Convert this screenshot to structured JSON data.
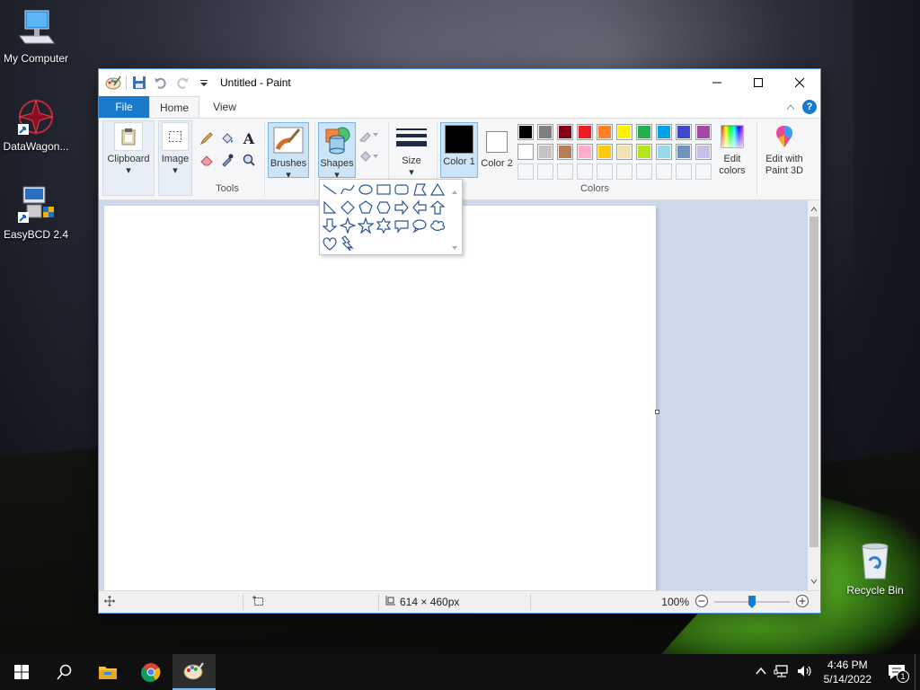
{
  "desktop": {
    "icons": [
      {
        "label": "My Computer",
        "icon": "computer-icon"
      },
      {
        "label": "DataWagon...",
        "icon": "datawagon-icon"
      },
      {
        "label": "EasyBCD 2.4",
        "icon": "easybcd-icon"
      },
      {
        "label": "Recycle Bin",
        "icon": "recycle-bin-icon"
      }
    ]
  },
  "window": {
    "title": "Untitled - Paint",
    "tabs": {
      "file": "File",
      "home": "Home",
      "view": "View"
    },
    "ribbon": {
      "clipboard": "Clipboard",
      "image": "Image",
      "tools_group": "Tools",
      "brushes": "Brushes",
      "shapes": "Shapes",
      "size": "Size",
      "color1": "Color 1",
      "color2": "Color 2",
      "edit_colors": "Edit colors",
      "edit_paint3d": "Edit with Paint 3D",
      "colors_group": "Colors"
    },
    "palette_row1": [
      "#000000",
      "#7f7f7f",
      "#880015",
      "#ed1c24",
      "#ff7f27",
      "#fff200",
      "#22b14c",
      "#00a2e8",
      "#3f48cc",
      "#a349a4"
    ],
    "palette_row2": [
      "#ffffff",
      "#c3c3c3",
      "#b97a57",
      "#ffaec9",
      "#ffc90e",
      "#efe4b0",
      "#b5e61d",
      "#99d9ea",
      "#7092be",
      "#c8bfe7"
    ],
    "status": {
      "size": "614 × 460px",
      "zoom": "100%"
    }
  },
  "taskbar": {
    "time": "4:46 PM",
    "date": "5/14/2022",
    "notifications": "1"
  }
}
